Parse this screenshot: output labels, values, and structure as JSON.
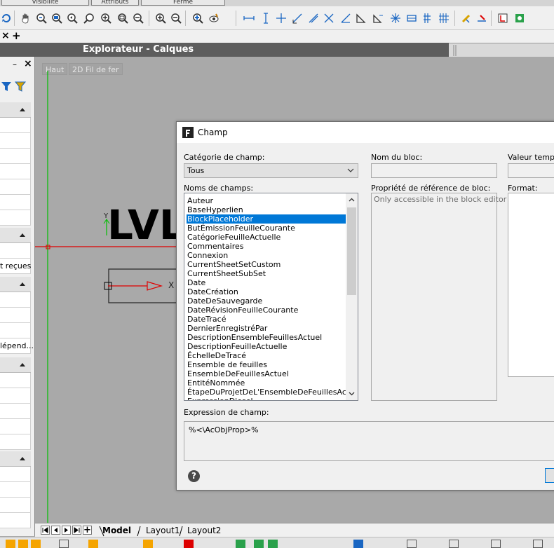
{
  "top_tabs": [
    "Visibilité",
    "Attributs",
    "Fermé"
  ],
  "toolbar": {
    "icons": [
      "layer-state-icon",
      "pan-hand-icon",
      "zoom-realtime-icon",
      "zoom-window-icon",
      "zoom-previous-icon",
      "zoom-dynamic-icon",
      "zoom-in-icon",
      "zoom-out-icon",
      "zoom-extents-icon",
      "zoom-all-icon",
      "zoom-plus-icon",
      "zoom-minus-icon",
      "zoom-object-icon",
      "show-icon",
      "dim-linear-icon",
      "dim-vertical-icon",
      "dim-ordinate-icon",
      "dim-aligned-icon",
      "dim-angular-icon",
      "dim-radius-icon",
      "dim-diameter-icon",
      "dim-baseline-icon",
      "dim-continue-icon",
      "snap-icon",
      "table-icon",
      "grid-icon",
      "edit-pen-icon",
      "break-icon",
      "field-icon",
      "area-icon"
    ]
  },
  "drawing_tabs": {
    "close": "×",
    "add": "+"
  },
  "explorer_title": "Explorateur - Calques",
  "left_panel": {
    "minus": "–",
    "close": "×",
    "row_text_1": "t reçues",
    "row_text_2": "lépend..."
  },
  "viewport": {
    "view_label": "Haut",
    "style_label": "2D Fil de fer",
    "drawing_text": "LVL",
    "axis_y": "Y",
    "axis_x": "X"
  },
  "dialog": {
    "title": "Champ",
    "category_label": "Catégorie de champ:",
    "category_value": "Tous",
    "field_names_label": "Noms de champs:",
    "block_name_label": "Nom du bloc:",
    "block_prop_label": "Propriété de référence de bloc:",
    "block_prop_hint": "Only accessible in the block editor",
    "temp_value_label": "Valeur tempor",
    "format_label": "Format:",
    "expression_label": "Expression de champ:",
    "expression_value": "%<\\AcObjProp>%",
    "help": "?",
    "field_names": [
      "Auteur",
      "BaseHyperlien",
      "BlockPlaceholder",
      "ButÉmissionFeuilleCourante",
      "CatégorieFeuilleActuelle",
      "Commentaires",
      "Connexion",
      "CurrentSheetSetCustom",
      "CurrentSheetSubSet",
      "Date",
      "DateCréation",
      "DateDeSauvegarde",
      "DateRévisionFeuilleCourante",
      "DateTracé",
      "DernierEnregistréPar",
      "DescriptionEnsembleFeuillesActuel",
      "DescriptionFeuilleActuelle",
      "ÉchelleDeTracé",
      "Ensemble de feuilles",
      "EnsembleDeFeuillesActuel",
      "EntitéNommée",
      "ÉtapeDuProjetDeL'EnsembleDeFeuillesActuel",
      "ExpressionDiesel"
    ],
    "selected_index": 2
  },
  "layout_tabs": [
    "Model",
    "Layout1",
    "Layout2"
  ],
  "nav_plus": "+",
  "colors": {
    "title_bg": "#5d5d5d",
    "selection": "#0078d7",
    "viewport": "#a9a9a9",
    "axis_red": "#e00000",
    "axis_green": "#00c000"
  }
}
